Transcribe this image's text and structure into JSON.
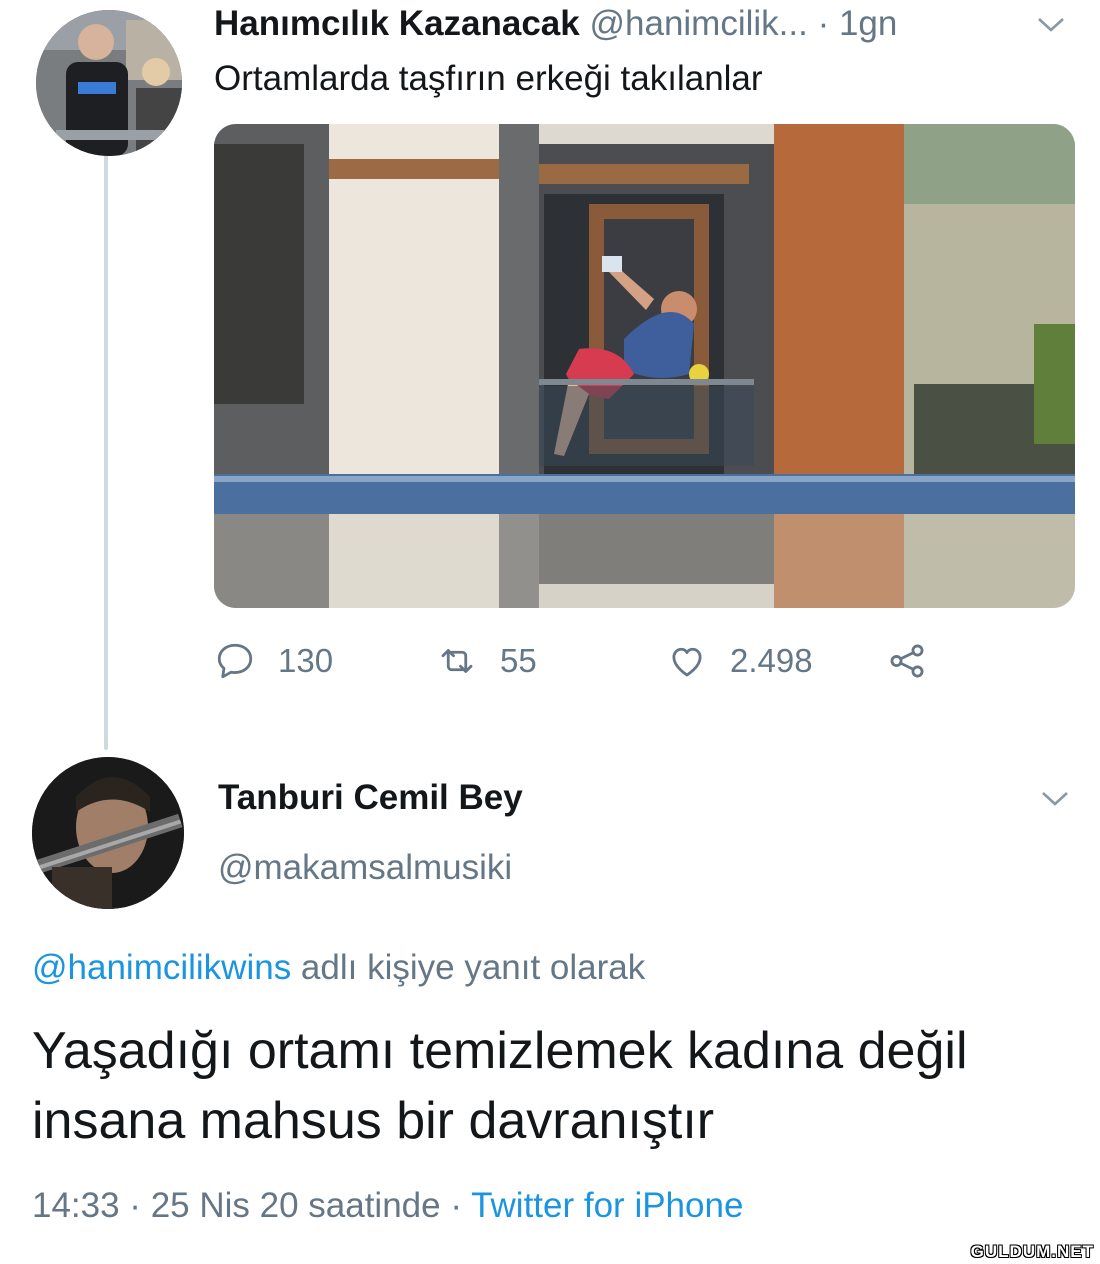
{
  "tweet1": {
    "name": "Hanımcılık Kazanacak",
    "handle": "@hanimcilik...",
    "time": "· 1gn",
    "text": "Ortamlarda taşfırın erkeği takılanlar",
    "replies": "130",
    "retweets": "55",
    "likes": "2.498"
  },
  "tweet2": {
    "name": "Tanburi Cemil Bey",
    "handle": "@makamsalmusiki",
    "reply_mention": "@hanimcilikwins",
    "reply_suffix": " adlı kişiye yanıt olarak",
    "text": "Yaşadığı ortamı temizlemek kadına değil insana mahsus bir davranıştır",
    "timestamp": "14:33 · 25 Nis 20 saatinde · ",
    "source": "Twitter for iPhone"
  },
  "watermark": "GULDUM.NET",
  "icons": {
    "reply": "speech-bubble-icon",
    "retweet": "retweet-arrows-icon",
    "like": "heart-icon",
    "share": "share-nodes-icon",
    "menu": "chevron-down-icon"
  },
  "colors": {
    "link": "#1b95e0",
    "secondary_text": "#657786",
    "thread_line": "#cfd9de"
  }
}
